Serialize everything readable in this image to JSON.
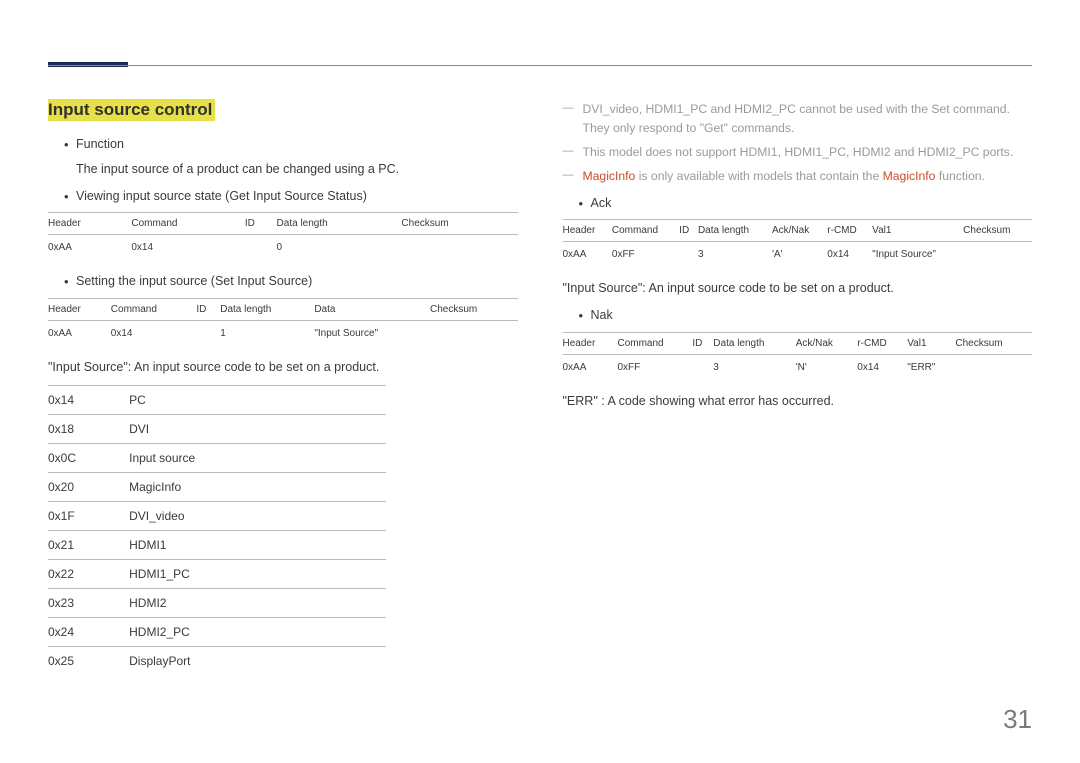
{
  "pageNumber": "31",
  "section": {
    "title": "Input source control"
  },
  "left": {
    "bullet1": "Function",
    "bullet1_sub": "The input source of a product can be changed using a PC.",
    "bullet2": "Viewing input source state (Get Input Source Status)",
    "table1": {
      "headers": [
        "Header",
        "Command",
        "ID",
        "Data length",
        "Checksum"
      ],
      "row": [
        "0xAA",
        "0x14",
        "",
        "0",
        ""
      ]
    },
    "bullet3": "Setting the input source (Set Input Source)",
    "table2": {
      "headers": [
        "Header",
        "Command",
        "ID",
        "Data length",
        "Data",
        "Checksum"
      ],
      "row": [
        "0xAA",
        "0x14",
        "",
        "1",
        "\"Input Source\"",
        ""
      ]
    },
    "desc1": "\"Input Source\": An input source code to be set on a product.",
    "codes": [
      [
        "0x14",
        "PC"
      ],
      [
        "0x18",
        "DVI"
      ],
      [
        "0x0C",
        "Input source"
      ],
      [
        "0x20",
        "MagicInfo"
      ],
      [
        "0x1F",
        "DVI_video"
      ],
      [
        "0x21",
        "HDMI1"
      ],
      [
        "0x22",
        "HDMI1_PC"
      ],
      [
        "0x23",
        "HDMI2"
      ],
      [
        "0x24",
        "HDMI2_PC"
      ],
      [
        "0x25",
        "DisplayPort"
      ]
    ]
  },
  "right": {
    "note1": "DVI_video, HDMI1_PC and HDMI2_PC cannot be used with the Set command. They only respond to \"Get\" commands.",
    "note2": "This model does not support HDMI1, HDMI1_PC, HDMI2 and HDMI2_PC ports.",
    "note3_accent1": "MagicInfo",
    "note3_mid": " is only available with models that contain the ",
    "note3_accent2": "MagicInfo",
    "note3_end": " function.",
    "bullet_ack": "Ack",
    "tableAck": {
      "headers": [
        "Header",
        "Command",
        "ID",
        "Data length",
        "Ack/Nak",
        "r-CMD",
        "Val1",
        "Checksum"
      ],
      "row": [
        "0xAA",
        "0xFF",
        "",
        "3",
        "'A'",
        "0x14",
        "\"Input Source\"",
        ""
      ]
    },
    "desc_ack": "\"Input Source\": An input source code to be set on a product.",
    "bullet_nak": "Nak",
    "tableNak": {
      "headers": [
        "Header",
        "Command",
        "ID",
        "Data length",
        "Ack/Nak",
        "r-CMD",
        "Val1",
        "Checksum"
      ],
      "row": [
        "0xAA",
        "0xFF",
        "",
        "3",
        "'N'",
        "0x14",
        "\"ERR\"",
        ""
      ]
    },
    "desc_err": "\"ERR\" : A code showing what error has occurred."
  }
}
